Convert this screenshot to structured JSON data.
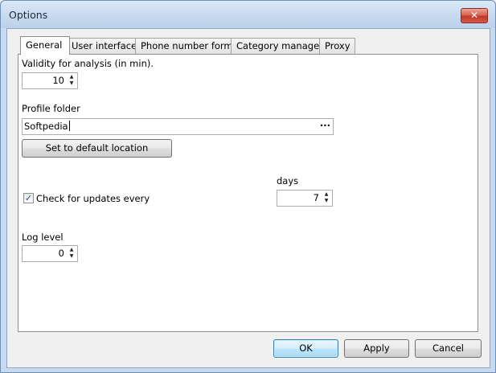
{
  "window": {
    "title": "Options",
    "close_symbol": "✕"
  },
  "tabs": [
    {
      "label": "General",
      "active": true
    },
    {
      "label": "User interface"
    },
    {
      "label": "Phone number format"
    },
    {
      "label": "Category manager"
    },
    {
      "label": "Proxy"
    }
  ],
  "general": {
    "validity_label": "Validity for analysis (in min).",
    "validity_value": "10",
    "profile_folder_label": "Profile folder",
    "profile_folder_value": "Softpedia",
    "browse_label": "···",
    "default_location_button": "Set to default location",
    "check_updates_label": "Check for updates every",
    "check_updates_checked": true,
    "check_mark": "✓",
    "days_label": "days",
    "days_value": "7",
    "log_level_label": "Log level",
    "log_level_value": "0",
    "spin_up": "▲",
    "spin_down": "▼"
  },
  "footer": {
    "ok": "OK",
    "apply": "Apply",
    "cancel": "Cancel"
  }
}
